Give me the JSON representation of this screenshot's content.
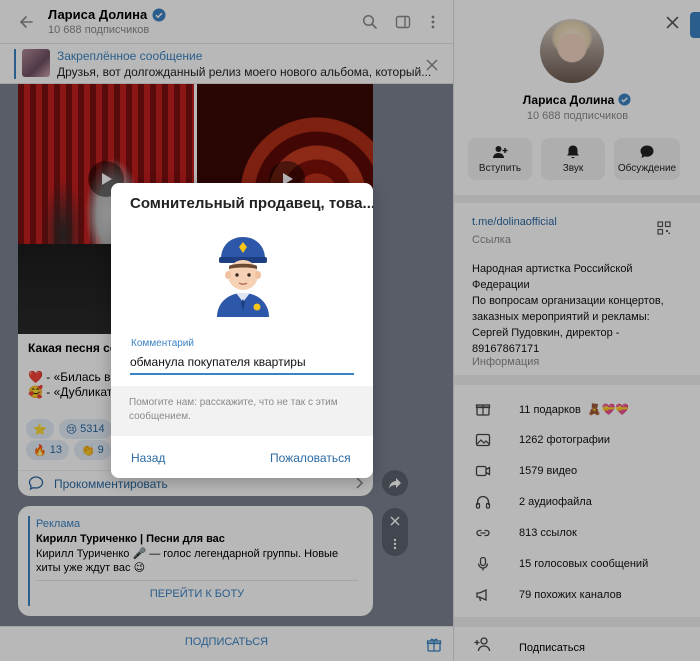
{
  "chat": {
    "title": "Лариса Долина",
    "subtitle": "10 688 подписчиков"
  },
  "pinned": {
    "title": "Закреплённое сообщение",
    "text": "Друзья, вот долгожданный релиз моего нового альбома, который..."
  },
  "post": {
    "heading": "Какая песня сег",
    "line1": "❤️ - «Билась в т",
    "line2": "🥰 - «Дубликат»",
    "reactions_row1": [
      {
        "emoji": "⭐",
        "count": ""
      },
      {
        "emoji": "😢",
        "count": "5314"
      }
    ],
    "reactions_row2": [
      {
        "emoji": "🔥",
        "count": "13"
      },
      {
        "emoji": "👏",
        "count": "9"
      }
    ],
    "comment_label": "Прокомментировать"
  },
  "ad": {
    "label": "Реклама",
    "title": "Кирилл Туриченко | Песни для вас",
    "text1": "Кирилл Туриченко 🎤 — голос легендарной группы. Новые",
    "text2": "хиты уже ждут вас 😉",
    "button": "ПЕРЕЙТИ К БОТУ"
  },
  "subscribe_label": "ПОДПИСАТЬСЯ",
  "profile": {
    "name": "Лариса Долина",
    "subscribers": "10 688 подписчиков",
    "actions": [
      "Вступить",
      "Звук",
      "Обсуждение"
    ],
    "link": "t.me/dolinaofficial",
    "link_caption": "Ссылка",
    "bio": "Народная артистка Российской Федерации\nПо вопросам организации концертов, заказных мероприятий и рекламы: Сергей Пудовкин, директор - 89167867171",
    "bio_caption": "Информация",
    "media": [
      {
        "icon": "gift-icon",
        "label": "11 подарков",
        "extra": "🧸💝💝"
      },
      {
        "icon": "photo-icon",
        "label": "1262 фотографии",
        "extra": ""
      },
      {
        "icon": "video-icon",
        "label": "1579 видео",
        "extra": ""
      },
      {
        "icon": "headphones-icon",
        "label": "2 аудиофайла",
        "extra": ""
      },
      {
        "icon": "link-icon",
        "label": "813 ссылок",
        "extra": ""
      },
      {
        "icon": "microphone-icon",
        "label": "15 голосовых сообщений",
        "extra": ""
      },
      {
        "icon": "megaphone-icon",
        "label": "79 похожих каналов",
        "extra": ""
      }
    ],
    "subscribe": "Подписаться"
  },
  "dialog": {
    "title": "Сомнительный продавец, това...",
    "comment_caption": "Комментарий",
    "comment_value": "обманула покупателя квартиры",
    "hint": "Помогите нам: расскажите, что не так с этим сообщением.",
    "back": "Назад",
    "report": "Пожаловаться"
  },
  "colors": {
    "accent": "#3a83c4",
    "link": "#2b6aa3",
    "chat_bg": "#7b8290"
  }
}
